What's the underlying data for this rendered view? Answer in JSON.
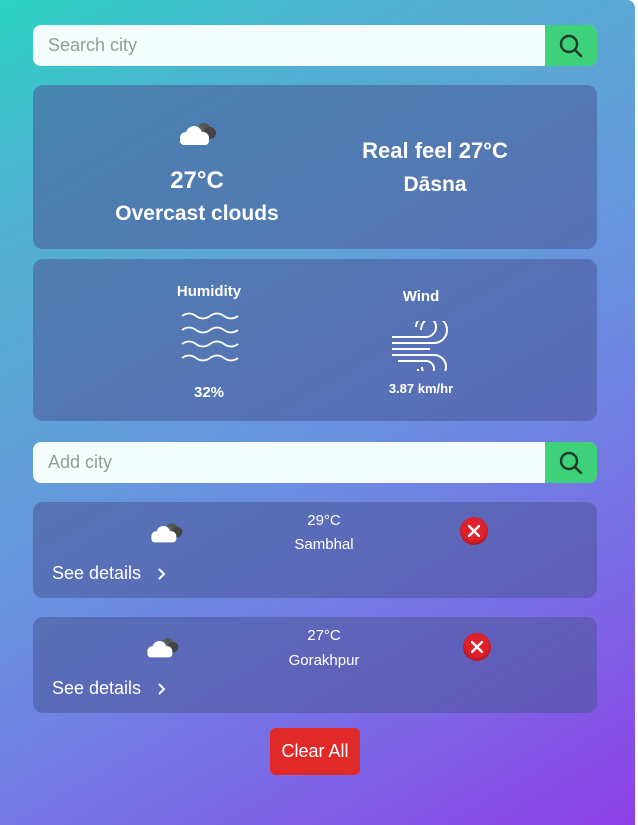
{
  "search": {
    "placeholder": "Search city",
    "button_icon": "search-icon"
  },
  "current": {
    "icon": "cloud-icon",
    "temperature": "27°C",
    "description": "Overcast clouds",
    "real_feel": "Real feel 27°C",
    "city": "Dāsna"
  },
  "stats": {
    "humidity_label": "Humidity",
    "humidity_icon": "waves-icon",
    "humidity_value": "32%",
    "wind_label": "Wind",
    "wind_icon": "wind-icon",
    "wind_value": "3.87 km/hr"
  },
  "add_city": {
    "placeholder": "Add city",
    "button_icon": "search-icon"
  },
  "saved_cities": [
    {
      "temperature": "29°C",
      "city": "Sambhal",
      "details_label": "See details",
      "icon": "cloud-icon"
    },
    {
      "temperature": "27°C",
      "city": "Gorakhpur",
      "details_label": "See details",
      "icon": "cloud-icon"
    }
  ],
  "clear_all_label": "Clear All",
  "colors": {
    "accent_green": "#3fd07a",
    "danger_red": "#e02a2a",
    "gradient_start": "#2cd3c4",
    "gradient_end": "#8e3fe6"
  }
}
